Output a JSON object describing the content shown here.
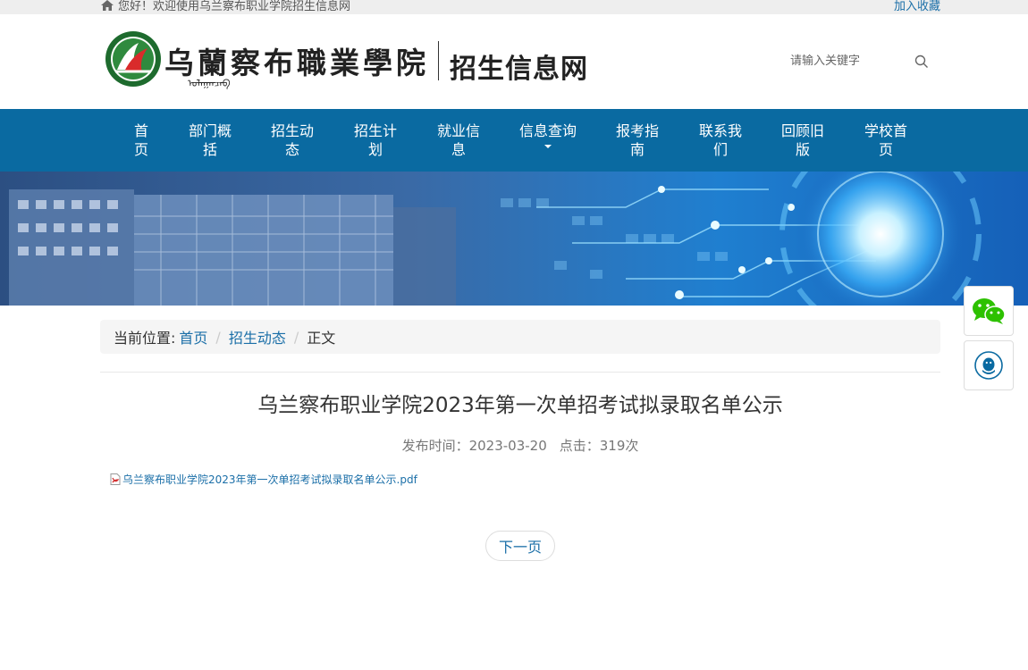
{
  "topbar": {
    "welcome": "您好！欢迎使用乌兰察布职业学院招生信息网",
    "favorite": "加入收藏"
  },
  "header": {
    "school_name": "乌蘭察布職業學院",
    "mongolian_script": "ᠤᠯᠠᠭᠠᠨᠴᠠᠪ",
    "site_name": "招生信息网",
    "search_placeholder": "请输入关键字"
  },
  "nav": {
    "items": [
      {
        "line1": "首",
        "line2": "页"
      },
      {
        "line1": "部门概",
        "line2": "括"
      },
      {
        "line1": "招生动",
        "line2": "态"
      },
      {
        "line1": "招生计",
        "line2": "划"
      },
      {
        "line1": "就业信",
        "line2": "息"
      },
      {
        "line1": "信息查询",
        "line2": ""
      },
      {
        "line1": "报考指",
        "line2": "南"
      },
      {
        "line1": "联系我",
        "line2": "们"
      },
      {
        "line1": "回顾旧",
        "line2": "版"
      },
      {
        "line1": "学校首",
        "line2": "页"
      }
    ]
  },
  "breadcrumb": {
    "prefix": "当前位置:",
    "home": "首页",
    "section": "招生动态",
    "current": "正文"
  },
  "article": {
    "title": "乌兰察布职业学院2023年第一次单招考试拟录取名单公示",
    "publish_label": "发布时间：2023-03-20",
    "clicks_label": "点击：319次",
    "attachment": "乌兰察布职业学院2023年第一次单招考试拟录取名单公示.pdf",
    "next_label": "下一页"
  },
  "colors": {
    "nav_bg": "#0a6aa1",
    "link": "#1b6fa8",
    "wechat": "#2dc100",
    "qq": "#0a6aa1"
  },
  "icons": [
    "home-icon",
    "search-icon",
    "pdf-icon",
    "wechat-icon",
    "qq-icon"
  ]
}
